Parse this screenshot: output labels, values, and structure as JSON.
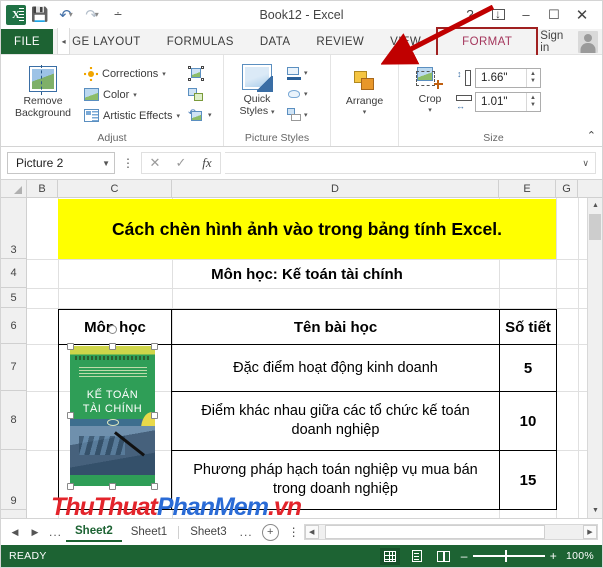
{
  "window": {
    "title": "Book12 - Excel",
    "quick_access": [
      {
        "name": "save-icon",
        "glyph": "💾"
      },
      {
        "name": "undo-icon",
        "glyph": "↶"
      },
      {
        "name": "redo-icon",
        "glyph": "↷"
      },
      {
        "name": "customize-qat-icon",
        "glyph": "⨇"
      }
    ],
    "controls": {
      "help": "?",
      "ribbon_display": "⤓",
      "minimize": "–",
      "maximize": "☐",
      "close": "✕"
    }
  },
  "tabs": {
    "file": "FILE",
    "scroll_left": "◂",
    "items": [
      {
        "label": "GE LAYOUT",
        "active": false,
        "clipped": true
      },
      {
        "label": "FORMULAS",
        "active": false
      },
      {
        "label": "DATA",
        "active": false
      },
      {
        "label": "REVIEW",
        "active": false
      },
      {
        "label": "VIEW",
        "active": false
      },
      {
        "label": "FORMAT",
        "active": true,
        "highlighted": true
      }
    ],
    "sign_in": "Sign in",
    "highlight_color": "#a02020",
    "format_text_color": "#a4365c"
  },
  "ribbon": {
    "groups": [
      {
        "name": "Adjust",
        "label": "Adjust",
        "big_buttons": [
          {
            "label_line1": "Remove",
            "label_line2": "Background",
            "icon": "remove-background-icon"
          }
        ],
        "menu_items": [
          {
            "label": "Corrections",
            "icon": "corrections-icon",
            "has_caret": true
          },
          {
            "label": "Color",
            "icon": "color-icon",
            "has_caret": true
          },
          {
            "label": "Artistic Effects",
            "icon": "artistic-effects-icon",
            "has_caret": true
          }
        ],
        "icon_only": [
          {
            "icon": "reset-picture-icon",
            "has_caret": false
          },
          {
            "icon": "compress-pictures-icon",
            "has_caret": false
          },
          {
            "icon": "change-picture-icon",
            "has_caret": true
          }
        ]
      },
      {
        "name": "Picture Styles",
        "label": "Picture Styles",
        "big_buttons": [
          {
            "label_line1": "Quick",
            "label_line2": "Styles",
            "icon": "quick-styles-icon",
            "has_caret": true
          }
        ],
        "icon_only": [
          {
            "icon": "picture-border-icon",
            "has_caret": true
          },
          {
            "icon": "picture-effects-icon",
            "has_caret": true
          },
          {
            "icon": "picture-layout-icon",
            "has_caret": true
          }
        ],
        "has_dialog_launcher": true
      },
      {
        "name": "Arrange",
        "label": "",
        "big_buttons": [
          {
            "label_line1": "Arrange",
            "label_line2": "",
            "icon": "arrange-icon",
            "has_caret": true
          }
        ]
      },
      {
        "name": "Size",
        "label": "Size",
        "big_buttons": [
          {
            "label_line1": "Crop",
            "label_line2": "",
            "icon": "crop-icon",
            "has_caret": true
          }
        ],
        "spinners": [
          {
            "name": "shape-height",
            "icon": "shape-height-icon",
            "value": "1.66\""
          },
          {
            "name": "shape-width",
            "icon": "shape-width-icon",
            "value": "1.01\""
          }
        ],
        "has_dialog_launcher": true
      }
    ],
    "collapse_icon": "⌃"
  },
  "formula_bar": {
    "name_box_value": "Picture 2",
    "name_box_caret": "▼",
    "more_dots": "⋮",
    "cancel_icon": "✕",
    "enter_icon": "✓",
    "function_icon": "fx",
    "input_value": "",
    "expand_caret": "∨"
  },
  "grid": {
    "columns": [
      "B",
      "C",
      "D",
      "E",
      "G"
    ],
    "rows": [
      "3",
      "4",
      "5",
      "6",
      "7",
      "8",
      "9"
    ],
    "cells": {
      "title": "Cách chèn hình ảnh vào trong bảng tính Excel.",
      "subtitle": "Môn học: Kế toán tài chính",
      "table_headers": [
        "Môn học",
        "Tên bài học",
        "Số tiết"
      ],
      "table_rows": [
        {
          "subject": "",
          "lesson": "Đặc điểm hoạt động kinh doanh",
          "periods": "5"
        },
        {
          "subject": "",
          "lesson": "Điểm khác nhau giữa các tổ chức kế toán doanh nghiệp",
          "periods": "10"
        },
        {
          "subject": "",
          "lesson": "Phương pháp hạch toán nghiệp vụ mua bán trong doanh nghiệp",
          "periods": "15"
        }
      ]
    },
    "highlight_color": "#ffff00",
    "picture": {
      "name": "book-cover-picture",
      "title_line1": "KẾ TOÁN",
      "title_line2": "TÀI CHÍNH",
      "selected": true
    }
  },
  "watermark": {
    "part1": "ThuThuat",
    "part2": "PhanMem",
    "part3": ".vn",
    "color1": "#e3242b",
    "color2": "#2a6bd6"
  },
  "sheet_bar": {
    "first_arrow": "◀",
    "last_arrow": "▶",
    "left_ellipsis": "...",
    "right_ellipsis": "...",
    "tabs": [
      {
        "label": "Sheet2",
        "active": true
      },
      {
        "label": "Sheet1",
        "active": false
      },
      {
        "label": "Sheet3",
        "active": false
      }
    ],
    "new_sheet": "+",
    "dots": "⋮",
    "scroll_left": "◀",
    "scroll_right": "▶"
  },
  "status_bar": {
    "status": "READY",
    "view_buttons": [
      {
        "name": "normal-view-button",
        "active": true
      },
      {
        "name": "page-layout-view-button",
        "active": false
      },
      {
        "name": "page-break-preview-button",
        "active": false
      }
    ],
    "zoom_out": "–",
    "zoom_in": "+",
    "zoom_level": "100%",
    "accent_color": "#1d6333"
  }
}
